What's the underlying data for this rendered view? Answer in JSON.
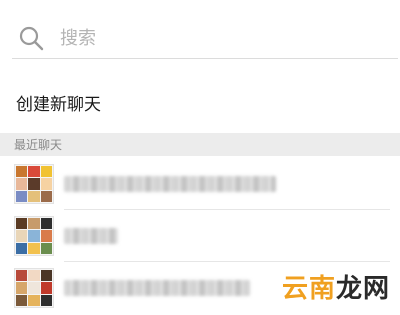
{
  "search": {
    "placeholder": "搜索",
    "icon": "search-icon"
  },
  "create_chat": {
    "label": "创建新聊天"
  },
  "recent_section": {
    "label": "最近聊天"
  },
  "chats": [
    {
      "name": "",
      "avatar_colors": [
        "#c9772f",
        "#d94a3a",
        "#f1c232",
        "#e8b89a",
        "#5b3b2a",
        "#f6d2a2",
        "#7a8cc4",
        "#e4c07a",
        "#9b6b4a"
      ]
    },
    {
      "name": "",
      "avatar_colors": [
        "#5a3b24",
        "#c79b6b",
        "#2f2f2f",
        "#e9d6b8",
        "#8ab4d8",
        "#d97b4a",
        "#3b6ea5",
        "#f2c14e",
        "#6b8e4e"
      ]
    },
    {
      "name": "",
      "avatar_colors": [
        "#b84a3a",
        "#f2d9c4",
        "#4a3526",
        "#d6a66a",
        "#efe6dc",
        "#c03a2b",
        "#7b5a3a",
        "#e5b35c",
        "#2e2e2e"
      ]
    }
  ],
  "watermark": {
    "part_a": "云南",
    "part_b": "龙网"
  },
  "colors": {
    "divider": "#dcdcdc",
    "section_bg": "#ececec",
    "section_text": "#8a8a8a",
    "watermark_accent": "#f0a020"
  }
}
